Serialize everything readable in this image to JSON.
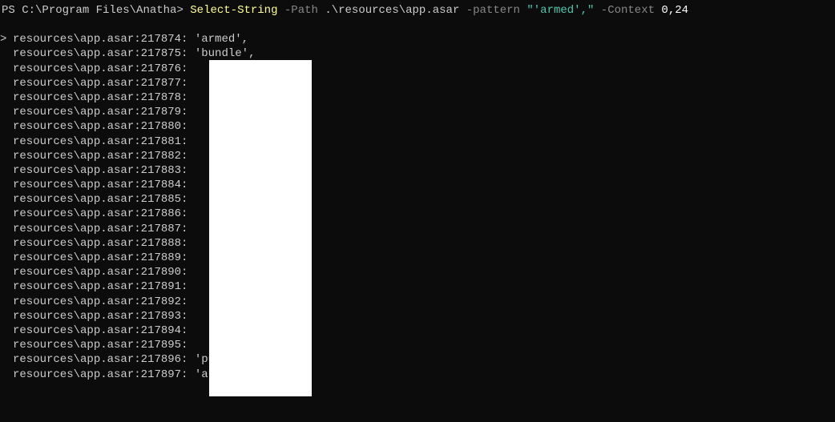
{
  "prompt": {
    "prefix": "PS",
    "path": "C:\\Program Files\\Anatha>",
    "cmdlet": "Select-String",
    "param_path_name": "-Path",
    "param_path_value": ".\\resources\\app.asar",
    "param_pattern_name": "-pattern",
    "param_pattern_value": "\"'armed',\"",
    "param_context_name": "-Context",
    "param_context_value": "0,24"
  },
  "output": [
    {
      "marker": ">",
      "file": "resources\\app.asar",
      "line": "217874",
      "text": "  'armed',"
    },
    {
      "marker": " ",
      "file": "resources\\app.asar",
      "line": "217875",
      "text": "  'bundle',"
    },
    {
      "marker": " ",
      "file": "resources\\app.asar",
      "line": "217876",
      "text": ""
    },
    {
      "marker": " ",
      "file": "resources\\app.asar",
      "line": "217877",
      "text": ""
    },
    {
      "marker": " ",
      "file": "resources\\app.asar",
      "line": "217878",
      "text": ""
    },
    {
      "marker": " ",
      "file": "resources\\app.asar",
      "line": "217879",
      "text": ""
    },
    {
      "marker": " ",
      "file": "resources\\app.asar",
      "line": "217880",
      "text": ""
    },
    {
      "marker": " ",
      "file": "resources\\app.asar",
      "line": "217881",
      "text": ""
    },
    {
      "marker": " ",
      "file": "resources\\app.asar",
      "line": "217882",
      "text": ""
    },
    {
      "marker": " ",
      "file": "resources\\app.asar",
      "line": "217883",
      "text": ""
    },
    {
      "marker": " ",
      "file": "resources\\app.asar",
      "line": "217884",
      "text": ""
    },
    {
      "marker": " ",
      "file": "resources\\app.asar",
      "line": "217885",
      "text": ""
    },
    {
      "marker": " ",
      "file": "resources\\app.asar",
      "line": "217886",
      "text": ""
    },
    {
      "marker": " ",
      "file": "resources\\app.asar",
      "line": "217887",
      "text": ""
    },
    {
      "marker": " ",
      "file": "resources\\app.asar",
      "line": "217888",
      "text": ""
    },
    {
      "marker": " ",
      "file": "resources\\app.asar",
      "line": "217889",
      "text": ""
    },
    {
      "marker": " ",
      "file": "resources\\app.asar",
      "line": "217890",
      "text": ""
    },
    {
      "marker": " ",
      "file": "resources\\app.asar",
      "line": "217891",
      "text": ""
    },
    {
      "marker": " ",
      "file": "resources\\app.asar",
      "line": "217892",
      "text": ""
    },
    {
      "marker": " ",
      "file": "resources\\app.asar",
      "line": "217893",
      "text": ""
    },
    {
      "marker": " ",
      "file": "resources\\app.asar",
      "line": "217894",
      "text": ""
    },
    {
      "marker": " ",
      "file": "resources\\app.asar",
      "line": "217895",
      "text": ""
    },
    {
      "marker": " ",
      "file": "resources\\app.asar",
      "line": "217896",
      "text": "  'pumpkin',"
    },
    {
      "marker": " ",
      "file": "resources\\app.asar",
      "line": "217897",
      "text": "  'athlete',"
    }
  ]
}
